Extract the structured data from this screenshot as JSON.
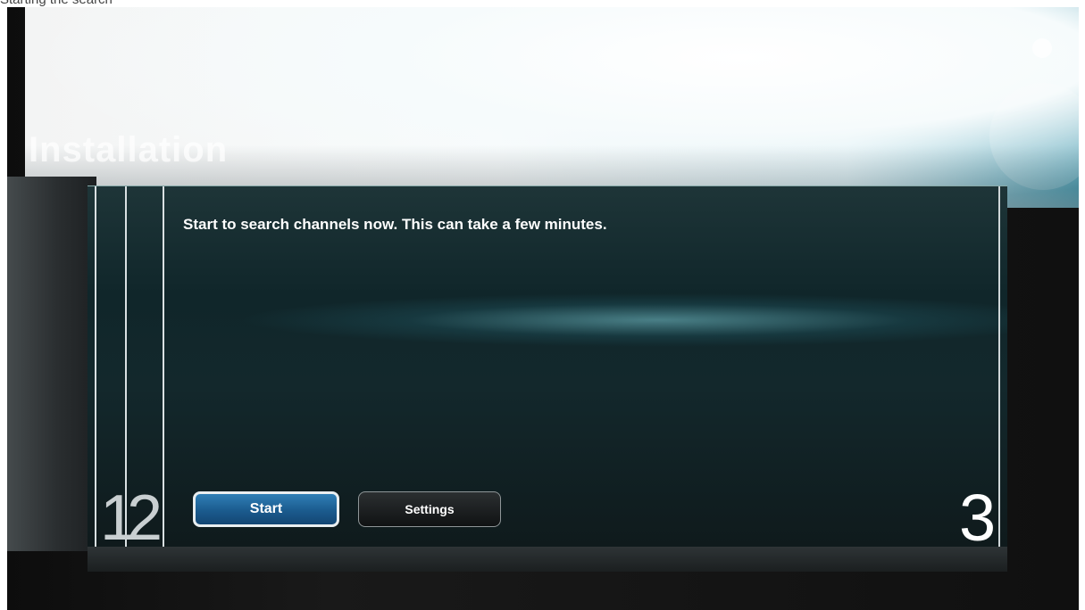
{
  "caption": "Starting the search",
  "header": {
    "title": "Installation"
  },
  "dialog": {
    "message": "Start to search channels now. This can take a few minutes.",
    "steps": [
      "1",
      "2",
      "3"
    ],
    "buttons": {
      "start_label": "Start",
      "settings_label": "Settings"
    }
  },
  "colors": {
    "start_button": "#1b5b8e",
    "panel_background": "#13282c",
    "header_glow": "#2f8fa7"
  }
}
